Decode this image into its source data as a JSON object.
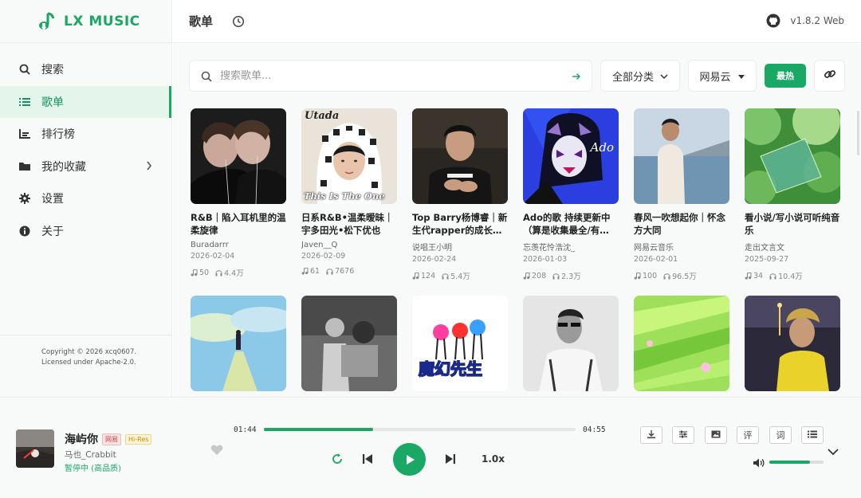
{
  "app": {
    "title": "LX MUSIC",
    "version": "v1.8.2 Web",
    "brand_color": "#1aa865"
  },
  "sidebar": {
    "items": [
      {
        "label": "搜索",
        "icon": "search-icon"
      },
      {
        "label": "歌单",
        "icon": "list-icon",
        "active": true
      },
      {
        "label": "排行榜",
        "icon": "chart-icon"
      },
      {
        "label": "我的收藏",
        "icon": "folder-icon"
      },
      {
        "label": "设置",
        "icon": "gear-icon"
      },
      {
        "label": "关于",
        "icon": "info-icon"
      }
    ],
    "footer": {
      "line1": "Copyright © 2026 xcq0607.",
      "line2": "Licensed under Apache-2.0."
    }
  },
  "header": {
    "title": "歌单"
  },
  "toolbar": {
    "search_placeholder": "搜索歌单...",
    "category": "全部分类",
    "source": "网易云",
    "sort": "最热"
  },
  "playlists": [
    {
      "name": "R&B｜陷入耳机里的温柔旋律",
      "author": "Buradarrr",
      "date": "2026-02-04",
      "songs": "50",
      "plays": "4.4万"
    },
    {
      "name": "日系R&B•温柔暧昧｜宇多田光•松下优也",
      "author": "Javen__Q",
      "date": "2026-02-09",
      "songs": "61",
      "plays": "7676"
    },
    {
      "name": "Top Barry杨博睿｜新生代rapper的成长轨迹",
      "author": "说唱王小明",
      "date": "2026-02-24",
      "songs": "124",
      "plays": "5.4万"
    },
    {
      "name": "Ado的歌 持续更新中（算是收集最全/有…",
      "author": "忘羡花怜浩沈_",
      "date": "2026-01-03",
      "songs": "208",
      "plays": "2.3万"
    },
    {
      "name": "春风一吹想起你｜怀念方大同",
      "author": "网易云音乐",
      "date": "2026-02-01",
      "songs": "100",
      "plays": "96.5万"
    },
    {
      "name": "看小说/写小说可听纯音乐",
      "author": "走出文言文",
      "date": "2025-09-27",
      "songs": "34",
      "plays": "10.4万"
    },
    {
      "name": "",
      "author": "",
      "date": "",
      "songs": "",
      "plays": ""
    },
    {
      "name": "",
      "author": "",
      "date": "",
      "songs": "",
      "plays": ""
    },
    {
      "name": "",
      "author": "",
      "date": "",
      "songs": "",
      "plays": ""
    },
    {
      "name": "",
      "author": "",
      "date": "",
      "songs": "",
      "plays": ""
    },
    {
      "name": "",
      "author": "",
      "date": "",
      "songs": "",
      "plays": ""
    },
    {
      "name": "",
      "author": "",
      "date": "",
      "songs": "",
      "plays": ""
    }
  ],
  "covers": [
    {
      "text_top": "",
      "text_bottom": ""
    },
    {
      "text_top": "Utada",
      "text_bottom": "This Is The One"
    },
    {
      "text_top": "",
      "text_bottom": ""
    },
    {
      "text_top": "Ado",
      "text_bottom": ""
    },
    {
      "text_top": "",
      "text_bottom": ""
    },
    {
      "text_top": "",
      "text_bottom": ""
    },
    {
      "text_top": "",
      "text_bottom": ""
    },
    {
      "text_top": "",
      "text_bottom": ""
    },
    {
      "text_top": "",
      "text_bottom": "魔幻先生"
    },
    {
      "text_top": "",
      "text_bottom": ""
    },
    {
      "text_top": "",
      "text_bottom": ""
    },
    {
      "text_top": "",
      "text_bottom": ""
    }
  ],
  "player": {
    "song": "海屿你",
    "badge1": "网易",
    "badge2": "Hi-Res",
    "artist": "马也_Crabbit",
    "status": "暂停中 (高品质)",
    "current_time": "01:44",
    "total_time": "04:55",
    "progress": 0.35,
    "speed": "1.0x",
    "volume": 0.75,
    "tools": [
      "download-icon",
      "sliders-icon",
      "image-icon",
      "评",
      "词",
      "list-icon"
    ]
  }
}
